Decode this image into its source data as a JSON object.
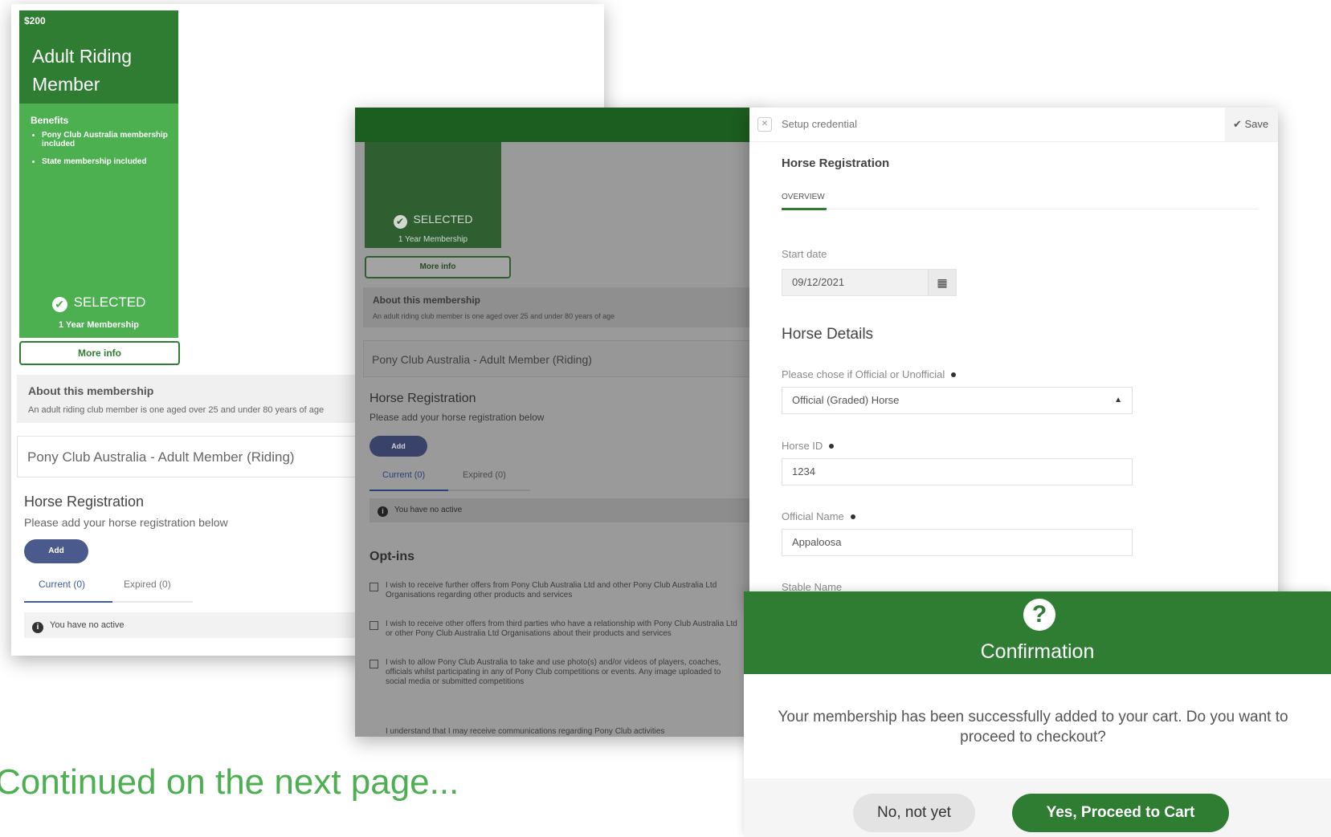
{
  "panel1": {
    "price": "$200",
    "card_title": "Adult Riding Member",
    "benefits_heading": "Benefits",
    "benefits": [
      "Pony Club Australia membership included",
      "State membership included"
    ],
    "selected_label": "SELECTED",
    "membership_term": "1 Year Membership",
    "more_info": "More info",
    "about_heading": "About this membership",
    "about_text": "An adult riding club member is one aged over 25 and under 80 years of age",
    "product_name": "Pony Club Australia - Adult Member (Riding)",
    "horse_reg_heading": "Horse Registration",
    "horse_reg_sub": "Please add your horse registration below",
    "add_label": "Add",
    "tab_current": "Current (0)",
    "tab_expired": "Expired (0)",
    "no_active": "You have no active"
  },
  "panel2": {
    "selected_label": "SELECTED",
    "membership_term": "1 Year Membership",
    "more_info": "More info",
    "about_heading": "About this membership",
    "about_text": "An adult riding club member is one aged over 25 and under 80 years of age",
    "product_name": "Pony Club Australia - Adult Member (Riding)",
    "horse_reg_heading": "Horse Registration",
    "horse_reg_sub": "Please add your horse registration below",
    "add_label": "Add",
    "tab_current": "Current (0)",
    "tab_expired": "Expired (0)",
    "no_active": "You have no active",
    "optins_heading": "Opt-ins",
    "optins": [
      "I wish to receive further offers from Pony Club Australia Ltd and other Pony Club Australia Ltd Organisations regarding other products and services",
      "I wish to receive other offers from third parties who have a relationship with Pony Club Australia Ltd or other Pony Club Australia Ltd Organisations about their products and services",
      "I wish to allow Pony Club Australia to take and use photo(s) and/or videos of players, coaches, officials whilst participating in any of Pony Club competitions or events. Any image uploaded to social media or submitted competitions"
    ],
    "optin_last": "I understand that I may receive communications regarding Pony Club activities"
  },
  "panel3": {
    "toolbar_title": "Setup credential",
    "save_label": "Save",
    "title": "Horse Registration",
    "tab_overview": "OVERVIEW",
    "start_date_label": "Start date",
    "start_date_value": "09/12/2021",
    "horse_details_heading": "Horse Details",
    "official_label": "Please chose if Official or Unofficial",
    "official_value": "Official (Graded) Horse",
    "horse_id_label": "Horse ID",
    "horse_id_value": "1234",
    "official_name_label": "Official Name",
    "official_name_value": "Appaloosa",
    "stable_name_label": "Stable Name"
  },
  "confirmation": {
    "title": "Confirmation",
    "message": "Your membership has been successfully added to your cart. Do you want to proceed to checkout?",
    "no_label": "No, not yet",
    "yes_label": "Yes, Proceed to Cart"
  },
  "footer_note": "Continued on the next page...",
  "colors": {
    "primary_green": "#2e7d32",
    "light_green": "#4caf50",
    "add_button": "#4b5a8c"
  }
}
